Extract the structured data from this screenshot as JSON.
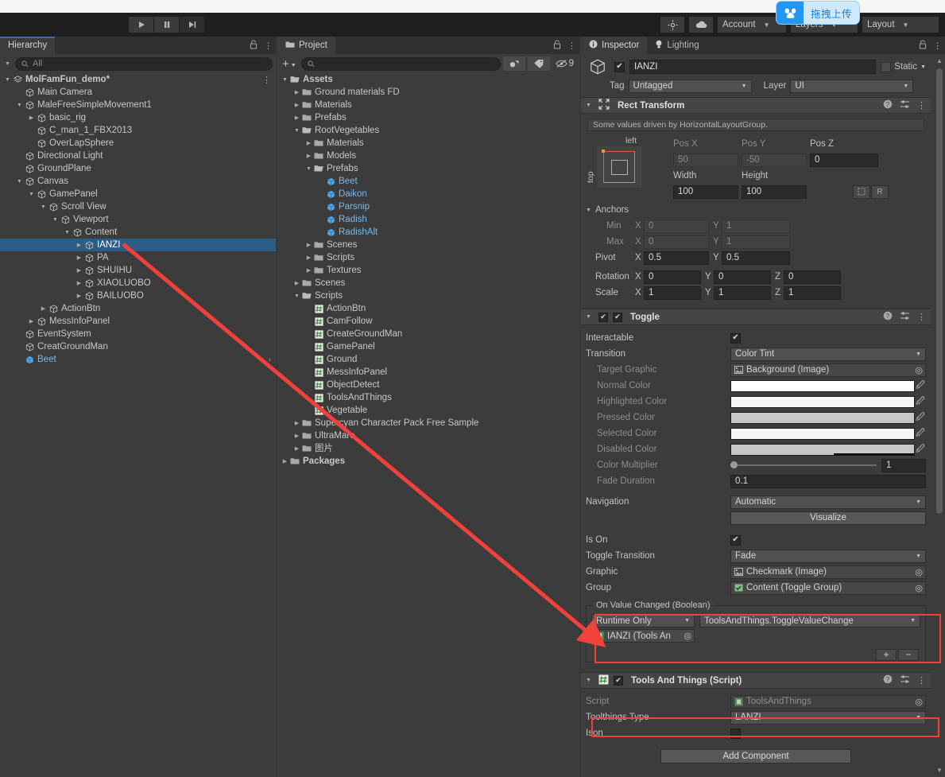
{
  "toolbar": {
    "play_icon": "play-icon",
    "pause_icon": "pause-icon",
    "step_icon": "step-icon",
    "cloud_icon": "cloud-icon",
    "services_icon": "services-icon",
    "account_label": "Account",
    "layers_label": "Layers",
    "layout_label": "Layout"
  },
  "upload_widget": {
    "label": "拖拽上传",
    "icon": "baidu-netdisk-icon",
    "accent": "#2196f3",
    "background": "#cfe8fb"
  },
  "hierarchy": {
    "tab_label": "Hierarchy",
    "search_placeholder": "All",
    "lock_icon": "lock-icon",
    "menu_icon": "kebab-menu-icon",
    "items": [
      {
        "label": "MolFamFun_demo*",
        "depth": 0,
        "arrow": "open",
        "icon": "scene-icon",
        "bold": true,
        "kebab": true
      },
      {
        "label": "Main Camera",
        "depth": 1,
        "arrow": "none",
        "icon": "gameobject-icon"
      },
      {
        "label": "MaleFreeSimpleMovement1",
        "depth": 1,
        "arrow": "open",
        "icon": "gameobject-icon"
      },
      {
        "label": "basic_rig",
        "depth": 2,
        "arrow": "closed",
        "icon": "gameobject-icon"
      },
      {
        "label": "C_man_1_FBX2013",
        "depth": 2,
        "arrow": "none",
        "icon": "gameobject-icon"
      },
      {
        "label": "OverLapSphere",
        "depth": 2,
        "arrow": "none",
        "icon": "gameobject-icon"
      },
      {
        "label": "Directional Light",
        "depth": 1,
        "arrow": "none",
        "icon": "gameobject-icon"
      },
      {
        "label": "GroundPlane",
        "depth": 1,
        "arrow": "none",
        "icon": "gameobject-icon"
      },
      {
        "label": "Canvas",
        "depth": 1,
        "arrow": "open",
        "icon": "gameobject-icon"
      },
      {
        "label": "GamePanel",
        "depth": 2,
        "arrow": "open",
        "icon": "gameobject-icon"
      },
      {
        "label": "Scroll View",
        "depth": 3,
        "arrow": "open",
        "icon": "gameobject-icon"
      },
      {
        "label": "Viewport",
        "depth": 4,
        "arrow": "open",
        "icon": "gameobject-icon"
      },
      {
        "label": "Content",
        "depth": 5,
        "arrow": "open",
        "icon": "gameobject-icon"
      },
      {
        "label": "IANZI",
        "depth": 6,
        "arrow": "closed",
        "icon": "gameobject-icon",
        "selected": true
      },
      {
        "label": "PA",
        "depth": 6,
        "arrow": "closed",
        "icon": "gameobject-icon"
      },
      {
        "label": "SHUIHU",
        "depth": 6,
        "arrow": "closed",
        "icon": "gameobject-icon"
      },
      {
        "label": "XIAOLUOBO",
        "depth": 6,
        "arrow": "closed",
        "icon": "gameobject-icon"
      },
      {
        "label": "BAILUOBO",
        "depth": 6,
        "arrow": "closed",
        "icon": "gameobject-icon"
      },
      {
        "label": "ActionBtn",
        "depth": 3,
        "arrow": "closed",
        "icon": "gameobject-icon"
      },
      {
        "label": "MessInfoPanel",
        "depth": 2,
        "arrow": "closed",
        "icon": "gameobject-icon"
      },
      {
        "label": "EventSystem",
        "depth": 1,
        "arrow": "none",
        "icon": "gameobject-icon"
      },
      {
        "label": "CreatGroundMan",
        "depth": 1,
        "arrow": "none",
        "icon": "gameobject-icon"
      },
      {
        "label": "Beet",
        "depth": 1,
        "arrow": "none",
        "icon": "prefab-icon",
        "prefab": true,
        "chevron": true
      }
    ]
  },
  "project": {
    "tab_label": "Project",
    "folder_icon": "folder-icon",
    "lock_icon": "lock-icon",
    "menu_icon": "kebab-menu-icon",
    "plus_label": "+",
    "search_placeholder": "",
    "hidden_count": "9",
    "items": [
      {
        "label": "Assets",
        "depth": 0,
        "arrow": "open",
        "icon": "folder-open-icon",
        "bold": true
      },
      {
        "label": "Ground materials FD",
        "depth": 1,
        "arrow": "closed",
        "icon": "folder-icon"
      },
      {
        "label": "Materials",
        "depth": 1,
        "arrow": "closed",
        "icon": "folder-icon"
      },
      {
        "label": "Prefabs",
        "depth": 1,
        "arrow": "closed",
        "icon": "folder-icon"
      },
      {
        "label": "RootVegetables",
        "depth": 1,
        "arrow": "open",
        "icon": "folder-open-icon"
      },
      {
        "label": "Materials",
        "depth": 2,
        "arrow": "closed",
        "icon": "folder-icon"
      },
      {
        "label": "Models",
        "depth": 2,
        "arrow": "closed",
        "icon": "folder-icon"
      },
      {
        "label": "Prefabs",
        "depth": 2,
        "arrow": "open",
        "icon": "folder-open-icon"
      },
      {
        "label": "Beet",
        "depth": 3,
        "arrow": "none",
        "icon": "prefab-icon",
        "prefab": true
      },
      {
        "label": "Daikon",
        "depth": 3,
        "arrow": "none",
        "icon": "prefab-icon",
        "prefab": true
      },
      {
        "label": "Parsnip",
        "depth": 3,
        "arrow": "none",
        "icon": "prefab-icon",
        "prefab": true
      },
      {
        "label": "Radish",
        "depth": 3,
        "arrow": "none",
        "icon": "prefab-icon",
        "prefab": true
      },
      {
        "label": "RadishAlt",
        "depth": 3,
        "arrow": "none",
        "icon": "prefab-icon",
        "prefab": true
      },
      {
        "label": "Scenes",
        "depth": 2,
        "arrow": "closed",
        "icon": "folder-icon"
      },
      {
        "label": "Scripts",
        "depth": 2,
        "arrow": "closed",
        "icon": "folder-icon"
      },
      {
        "label": "Textures",
        "depth": 2,
        "arrow": "closed",
        "icon": "folder-icon"
      },
      {
        "label": "Scenes",
        "depth": 1,
        "arrow": "closed",
        "icon": "folder-icon"
      },
      {
        "label": "Scripts",
        "depth": 1,
        "arrow": "open",
        "icon": "folder-open-icon"
      },
      {
        "label": "ActionBtn",
        "depth": 2,
        "arrow": "none",
        "icon": "csharp-script-icon",
        "script": true
      },
      {
        "label": "CamFollow",
        "depth": 2,
        "arrow": "none",
        "icon": "csharp-script-icon",
        "script": true
      },
      {
        "label": "CreateGroundMan",
        "depth": 2,
        "arrow": "none",
        "icon": "csharp-script-icon",
        "script": true
      },
      {
        "label": "GamePanel",
        "depth": 2,
        "arrow": "none",
        "icon": "csharp-script-icon",
        "script": true
      },
      {
        "label": "Ground",
        "depth": 2,
        "arrow": "none",
        "icon": "csharp-script-icon",
        "script": true
      },
      {
        "label": "MessInfoPanel",
        "depth": 2,
        "arrow": "none",
        "icon": "csharp-script-icon",
        "script": true
      },
      {
        "label": "ObjectDetect",
        "depth": 2,
        "arrow": "none",
        "icon": "csharp-script-icon",
        "script": true
      },
      {
        "label": "ToolsAndThings",
        "depth": 2,
        "arrow": "none",
        "icon": "csharp-script-icon",
        "script": true
      },
      {
        "label": "Vegetable",
        "depth": 2,
        "arrow": "none",
        "icon": "csharp-script-icon",
        "script": true
      },
      {
        "label": "Supercyan Character Pack Free Sample",
        "depth": 1,
        "arrow": "closed",
        "icon": "folder-icon"
      },
      {
        "label": "UltraMare",
        "depth": 1,
        "arrow": "closed",
        "icon": "folder-icon"
      },
      {
        "label": "图片",
        "depth": 1,
        "arrow": "closed",
        "icon": "folder-icon"
      },
      {
        "label": "Packages",
        "depth": 0,
        "arrow": "closed",
        "icon": "folder-icon",
        "bold": true
      }
    ]
  },
  "inspector": {
    "tab_label": "Inspector",
    "tab_icon": "info-icon",
    "lighting_tab_label": "Lighting",
    "lighting_tab_icon": "light-bulb-icon",
    "lock_icon": "lock-icon",
    "menu_icon": "kebab-menu-icon",
    "gameobject": {
      "enabled": true,
      "name": "IANZI",
      "static_label": "Static",
      "static_checked": false,
      "tag_label": "Tag",
      "tag_value": "Untagged",
      "layer_label": "Layer",
      "layer_value": "UI",
      "icon": "gameobject-icon"
    },
    "rect_transform": {
      "title": "Rect Transform",
      "icon": "rect-transform-icon",
      "help_icon": "help-icon",
      "preset_icon": "preset-icon",
      "menu_icon": "kebab-menu-icon",
      "helpbox": "Some values driven by HorizontalLayoutGroup.",
      "anchor_left_label": "left",
      "anchor_top_label": "top",
      "pos_x_label": "Pos X",
      "pos_x_value": "50",
      "pos_y_label": "Pos Y",
      "pos_y_value": "-50",
      "pos_z_label": "Pos Z",
      "pos_z_value": "0",
      "width_label": "Width",
      "width_value": "100",
      "height_label": "Height",
      "height_value": "100",
      "blueprint_icon": "blueprint-icon",
      "raw_label": "R",
      "anchors_label": "Anchors",
      "min_label": "Min",
      "min_x": "0",
      "min_y": "1",
      "max_label": "Max",
      "max_x": "0",
      "max_y": "1",
      "pivot_label": "Pivot",
      "pivot_x": "0.5",
      "pivot_y": "0.5",
      "rotation_label": "Rotation",
      "rot_x": "0",
      "rot_y": "0",
      "rot_z": "0",
      "scale_label": "Scale",
      "scale_x": "1",
      "scale_y": "1",
      "scale_z": "1"
    },
    "toggle": {
      "title": "Toggle",
      "icon": "toggle-icon",
      "enabled": true,
      "help_icon": "help-icon",
      "preset_icon": "preset-icon",
      "menu_icon": "kebab-menu-icon",
      "interactable_label": "Interactable",
      "interactable_checked": true,
      "transition_label": "Transition",
      "transition_value": "Color Tint",
      "target_graphic_label": "Target Graphic",
      "target_graphic_value": "Background (Image)",
      "normal_color_label": "Normal Color",
      "normal_color": "#ffffff",
      "highlighted_color_label": "Highlighted Color",
      "highlighted_color": "#f5f5f5",
      "pressed_color_label": "Pressed Color",
      "pressed_color": "#c8c8c8",
      "selected_color_label": "Selected Color",
      "selected_color": "#f5f5f5",
      "disabled_color_label": "Disabled Color",
      "disabled_color": "#c8c8c8",
      "color_multiplier_label": "Color Multiplier",
      "color_multiplier_value": "1",
      "fade_duration_label": "Fade Duration",
      "fade_duration_value": "0.1",
      "navigation_label": "Navigation",
      "navigation_value": "Automatic",
      "visualize_label": "Visualize",
      "is_on_label": "Is On",
      "is_on_checked": true,
      "toggle_transition_label": "Toggle Transition",
      "toggle_transition_value": "Fade",
      "graphic_label": "Graphic",
      "graphic_value": "Checkmark  (Image)",
      "group_label": "Group",
      "group_value": "Content (Toggle Group)",
      "event": {
        "title": "On Value Changed (Boolean)",
        "call_state": "Runtime Only",
        "function": "ToolsAndThings.ToggleValueChange",
        "object": "IANZI (Tools An",
        "add_label": "+",
        "remove_label": "−"
      }
    },
    "script_component": {
      "title": "Tools And Things (Script)",
      "icon": "csharp-script-icon",
      "enabled": true,
      "help_icon": "help-icon",
      "preset_icon": "preset-icon",
      "menu_icon": "kebab-menu-icon",
      "script_label": "Script",
      "script_value": "ToolsAndThings",
      "toolthings_type_label": "Toolthings Type",
      "toolthings_type_value": "LANZI",
      "ison_label": "Ison",
      "ison_checked": false
    },
    "add_component_label": "Add Component"
  },
  "annotation": {
    "arrow_color": "#f0413b",
    "highlight_color": "#f0413b"
  }
}
